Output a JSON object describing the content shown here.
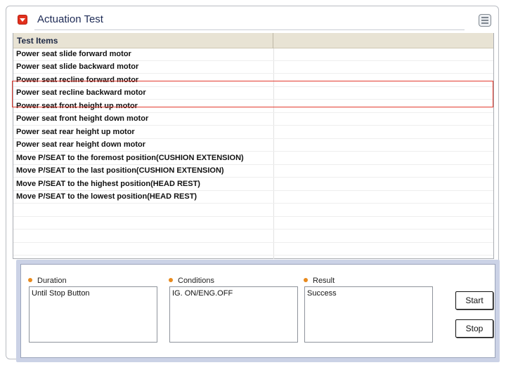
{
  "window": {
    "title": "Actuation Test"
  },
  "table": {
    "header": "Test Items",
    "rows": [
      "Power seat slide forward motor",
      "Power seat slide backward motor",
      "Power seat recline forward motor",
      "Power seat recline backward motor",
      "Power seat front height up motor",
      "Power seat front height down motor",
      "Power seat rear height up motor",
      "Power seat rear height down motor",
      "Move P/SEAT to the foremost position(CUSHION EXTENSION)",
      "Move P/SEAT to the last position(CUSHION EXTENSION)",
      "Move P/SEAT to the highest position(HEAD REST)",
      "Move P/SEAT to the lowest position(HEAD REST)",
      "",
      "",
      "",
      ""
    ]
  },
  "panel": {
    "duration": {
      "label": "Duration",
      "value": "Until Stop Button"
    },
    "conditions": {
      "label": "Conditions",
      "value": "IG. ON/ENG.OFF"
    },
    "result": {
      "label": "Result",
      "value": "Success"
    },
    "start_label": "Start",
    "stop_label": "Stop"
  },
  "colors": {
    "highlight": "#e33a2e",
    "panel_bg": "#cbd2e6",
    "header_bg": "#e8e3d4",
    "bullet": "#e88a1e"
  }
}
